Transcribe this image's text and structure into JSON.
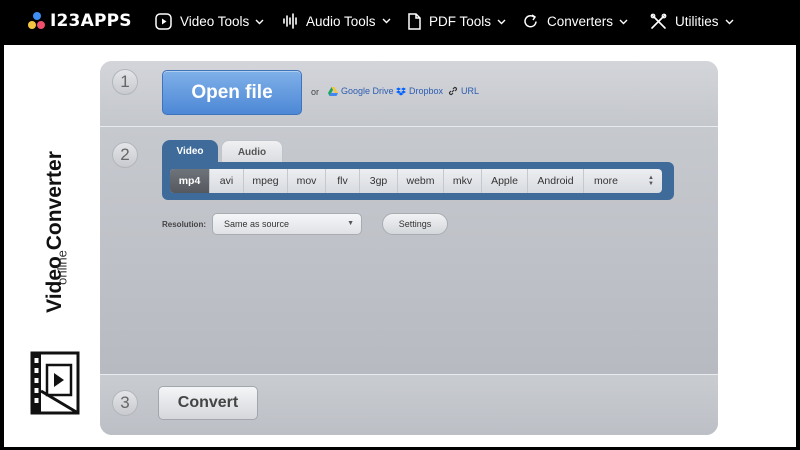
{
  "topbar": {
    "logo_text": "I23APPS",
    "nav": [
      {
        "label": "Video Tools",
        "icon": "play-circle-icon"
      },
      {
        "label": "Audio Tools",
        "icon": "sound-wave-icon"
      },
      {
        "label": "PDF Tools",
        "icon": "document-icon"
      },
      {
        "label": "Converters",
        "icon": "refresh-icon"
      },
      {
        "label": "Utilities",
        "icon": "tools-icon"
      }
    ]
  },
  "brand": {
    "title": "Video Converter",
    "subtitle": "online"
  },
  "step1": {
    "number": "1",
    "open_label": "Open file",
    "or_label": "or",
    "google_drive": "Google Drive",
    "dropbox": "Dropbox",
    "url": "URL"
  },
  "step2": {
    "number": "2",
    "tab_video": "Video",
    "tab_audio": "Audio",
    "formats": [
      "mp4",
      "avi",
      "mpeg",
      "mov",
      "flv",
      "3gp",
      "webm",
      "mkv",
      "Apple",
      "Android",
      "more"
    ],
    "active_format": "mp4",
    "resolution_label": "Resolution:",
    "resolution_value": "Same as source",
    "settings_label": "Settings"
  },
  "step3": {
    "number": "3",
    "convert_label": "Convert"
  },
  "colors": {
    "primary_blue": "#4d88d6",
    "tab_blue": "#3f6b9b",
    "panel_gray": "#c4c7cc"
  }
}
